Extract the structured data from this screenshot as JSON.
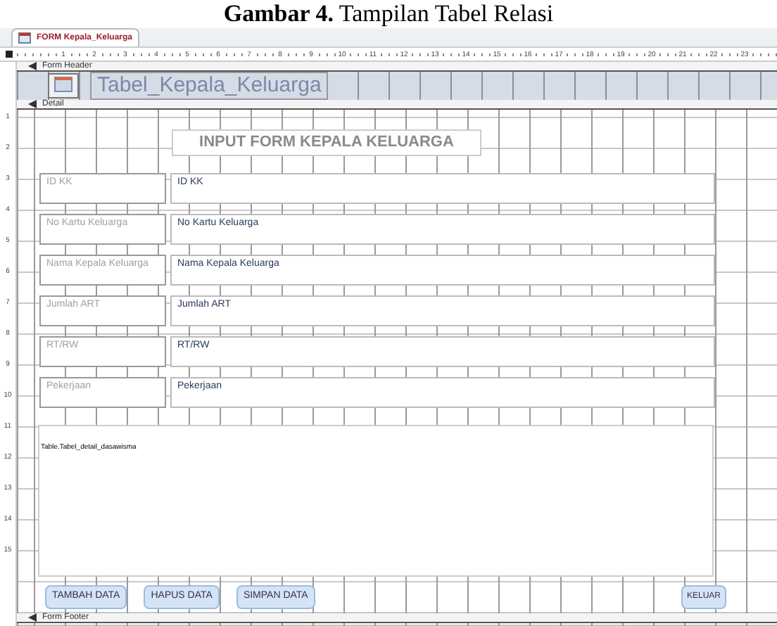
{
  "caption": "**Gambar 4.** Tampilan Tabel Relasi",
  "tab": {
    "title": "FORM Kepala_Keluarga",
    "selected": true
  },
  "ruler": [
    "1",
    "2",
    "3",
    "4",
    "5",
    "6",
    "7",
    "8",
    "9",
    "10",
    "11",
    "12",
    "13",
    "14",
    "15",
    "16",
    "17",
    "18",
    "19",
    "20",
    "21",
    "22",
    "23"
  ],
  "vertical_ruler": [
    "1",
    "2",
    "3",
    "4",
    "5",
    "6",
    "7",
    "8",
    "9",
    "10",
    "11",
    "12",
    "13",
    "14",
    "15"
  ],
  "form_header": {
    "section": "Form Header",
    "label": "Tabel_Kepala_Keluarga"
  },
  "detail": {
    "section": "Detail",
    "title": "INPUT FORM KEPALA KELUARGA",
    "fields": [
      {
        "label": "ID KK",
        "value": "ID KK"
      },
      {
        "label": "No Kartu Keluarga",
        "value": "No Kartu Keluarga"
      },
      {
        "label": "Nama Kepala Keluarga",
        "value": "Nama Kepala Keluarga"
      },
      {
        "label": "Jumlah ART",
        "value": "Jumlah ART"
      },
      {
        "label": "RT/RW",
        "value": "RT/RW"
      },
      {
        "label": "Pekerjaan",
        "value": "Pekerjaan"
      }
    ],
    "subform": {
      "label": "Table.Tabel_detail_dasawisma"
    },
    "buttons": [
      "TAMBAH DATA",
      "HAPUS DATA",
      "SIMPAN DATA"
    ],
    "exit_button": "KELUAR"
  },
  "form_footer": {
    "section": "Form Footer"
  }
}
